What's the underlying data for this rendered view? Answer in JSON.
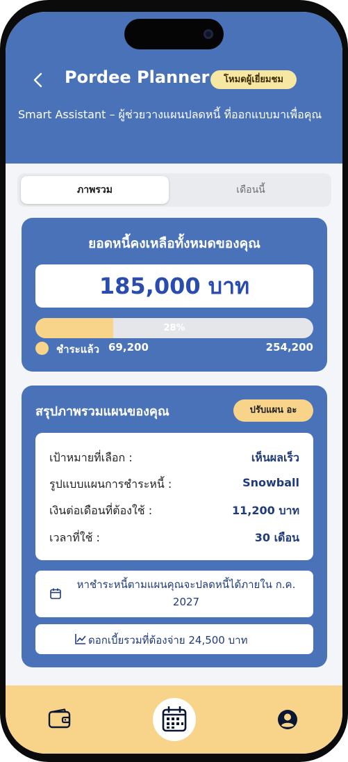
{
  "header": {
    "title": "Pordee Planner",
    "mode_badge": "โหมดผู้เยี่ยมชม",
    "subtitle": "Smart Assistant – ผู้ช่วยวางแผนปลดหนี้ ที่ออกแบบมาเพื่อคุณ",
    "back_icon": "chevron-left-icon"
  },
  "tabs": [
    {
      "label": "ภาพรวม",
      "active": true
    },
    {
      "label": "เดือนนี้",
      "active": false
    }
  ],
  "debt_card": {
    "title": "ยอดหนี้คงเหลือทั้งหมดของคุณ",
    "amount": "185,000 บาท",
    "progress_percent": 28,
    "progress_label": "28%",
    "paid_label": "ชำระแล้ว",
    "paid_value": "69,200",
    "total_value": "254,200"
  },
  "summary_card": {
    "title": "สรุปภาพรวมแผนของคุณ",
    "adjust_button": "ปรับแผน อะ",
    "rows": [
      {
        "label": "เป้าหมายที่เลือก :",
        "value": "เห็นผลเร็ว"
      },
      {
        "label": "รูปแบบแผนการชำระหนี้ :",
        "value": "Snowball"
      },
      {
        "label": "เงินต่อเดือนที่ต้องใช้ :",
        "value": "11,200 บาท"
      },
      {
        "label": "เวลาที่ใช้ :",
        "value": "30 เดือน"
      }
    ],
    "info_payoff": "หาชำระหนี้ตามแผนคุณจะปลดหนี้ได้ภายใน ก.ค. 2027",
    "info_interest": "ดอกเบี้ยรวมที่ต้องจ่าย 24,500 บาท"
  },
  "bottom_nav": {
    "items": [
      {
        "icon": "wallet-icon"
      },
      {
        "icon": "calendar-icon",
        "active": true
      },
      {
        "icon": "account-icon"
      }
    ]
  },
  "colors": {
    "primary": "#4a72b8",
    "accent": "#f7d48a",
    "amount_text": "#2a4cae",
    "badge_bg": "#f6e7a3"
  }
}
